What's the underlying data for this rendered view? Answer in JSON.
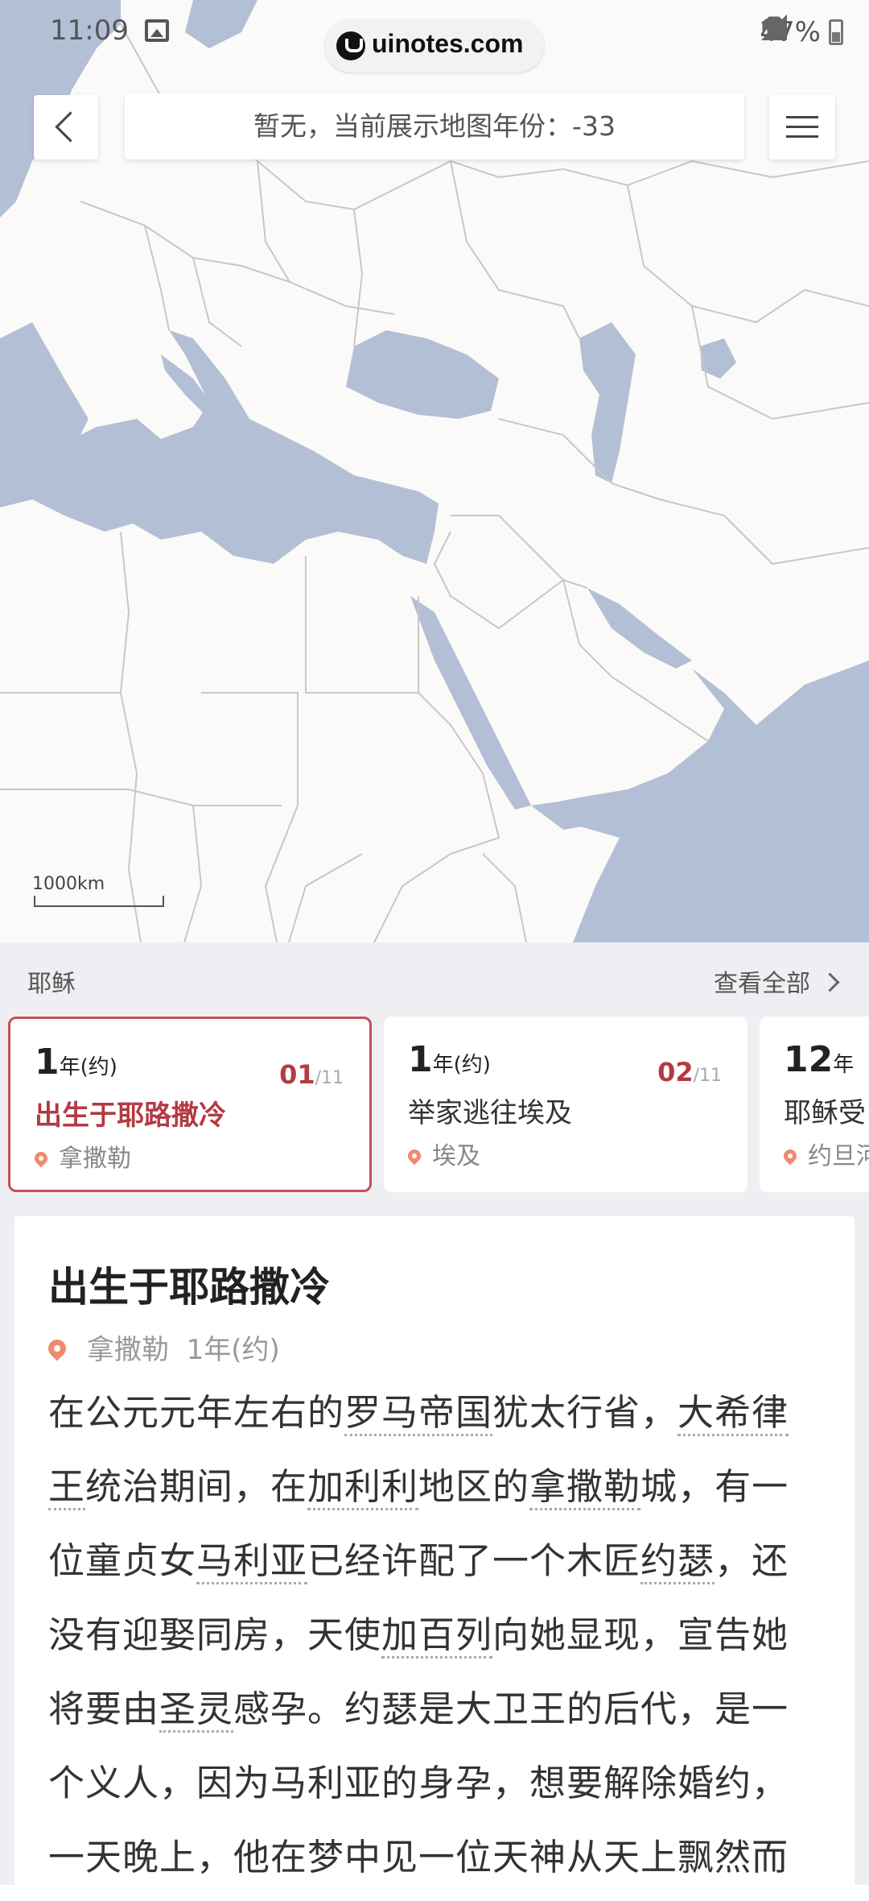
{
  "status_bar": {
    "time": "11:09",
    "url": "uinotes.com",
    "battery": "47%"
  },
  "header": {
    "year_banner": "暂无，当前展示地图年份：-33"
  },
  "map": {
    "scale_label": "1000km",
    "colors": {
      "land": "#fbfaf8",
      "water": "#b3bfd5",
      "border": "#c7c7c7"
    }
  },
  "timeline": {
    "title": "耶稣",
    "view_all": "查看全部",
    "accent": "#b33a43",
    "events": [
      {
        "year": "1",
        "suffix": "年(约)",
        "index": "01",
        "total": "/11",
        "title": "出生于耶路撒冷",
        "place": "拿撒勒"
      },
      {
        "year": "1",
        "suffix": "年(约)",
        "index": "02",
        "total": "/11",
        "title": "举家逃往埃及",
        "place": "埃及"
      },
      {
        "year": "12",
        "suffix": "年",
        "index": "",
        "total": "",
        "title": "耶稣受",
        "place": "约旦河"
      }
    ]
  },
  "detail": {
    "title": "出生于耶路撒冷",
    "place": "拿撒勒",
    "year": "1年(约)",
    "body": [
      {
        "t": "在公元元年左右的",
        "link": false
      },
      {
        "t": "罗马帝国",
        "link": true
      },
      {
        "t": "犹太行省，",
        "link": false
      },
      {
        "t": "大希律王",
        "link": true
      },
      {
        "t": "统治期间，在",
        "link": false
      },
      {
        "t": "加利利",
        "link": true
      },
      {
        "t": "地区的",
        "link": false
      },
      {
        "t": "拿撒勒",
        "link": true
      },
      {
        "t": "城，有一位童贞女",
        "link": false
      },
      {
        "t": "马利亚",
        "link": true
      },
      {
        "t": "已经许配了一个木匠",
        "link": false
      },
      {
        "t": "约瑟",
        "link": true
      },
      {
        "t": "，还没有迎娶同房，天使",
        "link": false
      },
      {
        "t": "加百列",
        "link": true
      },
      {
        "t": "向她显现，宣告她将要由",
        "link": false
      },
      {
        "t": "圣灵",
        "link": true
      },
      {
        "t": "感孕。约瑟是大卫王的后代，是一个义人，因为马利亚的身孕，想要解除婚约，一天晚上，他在梦中见一位天神从天上飘然而",
        "link": false
      }
    ]
  }
}
